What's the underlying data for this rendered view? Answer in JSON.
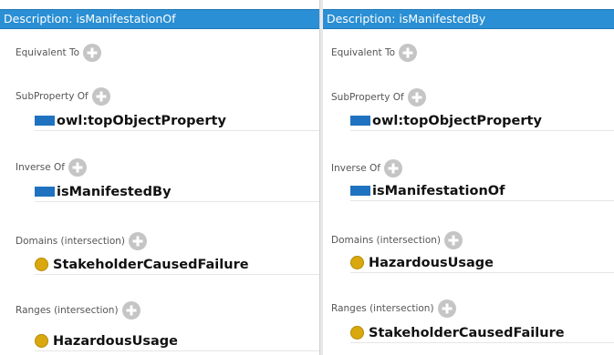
{
  "colors": {
    "title_bar": "#2a8fd4",
    "property_icon": "#1f72bf",
    "class_icon": "#d9a80f",
    "add_icon": "#c5c5c5"
  },
  "panels": {
    "left": {
      "title": "Description: isManifestationOf",
      "equivalent_to": {
        "label": "Equivalent To"
      },
      "subproperty_of": {
        "label": "SubProperty Of",
        "value": "owl:topObjectProperty",
        "icon": "object-property-icon"
      },
      "inverse_of": {
        "label": "Inverse Of",
        "value": "isManifestedBy",
        "icon": "object-property-icon"
      },
      "domains": {
        "label": "Domains (intersection)",
        "value": "StakeholderCausedFailure",
        "icon": "class-icon"
      },
      "ranges": {
        "label": "Ranges (intersection)",
        "value": "HazardousUsage",
        "icon": "class-icon"
      }
    },
    "right": {
      "title": "Description: isManifestedBy",
      "equivalent_to": {
        "label": "Equivalent To"
      },
      "subproperty_of": {
        "label": "SubProperty Of",
        "value": "owl:topObjectProperty",
        "icon": "object-property-icon"
      },
      "inverse_of": {
        "label": "Inverse Of",
        "value": "isManifestationOf",
        "icon": "object-property-icon"
      },
      "domains": {
        "label": "Domains (intersection)",
        "value": "HazardousUsage",
        "icon": "class-icon"
      },
      "ranges": {
        "label": "Ranges (intersection)",
        "value": "StakeholderCausedFailure",
        "icon": "class-icon"
      }
    }
  }
}
